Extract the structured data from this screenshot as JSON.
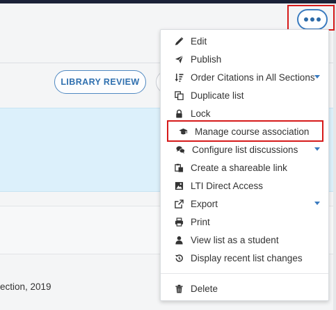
{
  "toolbar": {
    "library_review_label": "LIBRARY REVIEW",
    "more_actions_icon": "ellipsis-icon"
  },
  "content": {
    "citation_fragment": "ection, 2019"
  },
  "menu": {
    "items": [
      {
        "label": "Edit",
        "icon": "pencil-icon",
        "has_submenu": false
      },
      {
        "label": "Publish",
        "icon": "paper-plane-icon",
        "has_submenu": false
      },
      {
        "label": "Order Citations in All Sections",
        "icon": "sort-icon",
        "has_submenu": true
      },
      {
        "label": "Duplicate list",
        "icon": "copy-icon",
        "has_submenu": false
      },
      {
        "label": "Lock",
        "icon": "lock-icon",
        "has_submenu": false
      },
      {
        "label": "Manage course association",
        "icon": "graduation-cap-icon",
        "has_submenu": false
      },
      {
        "label": "Configure list discussions",
        "icon": "comments-icon",
        "has_submenu": true
      },
      {
        "label": "Create a shareable link",
        "icon": "clipboard-icon",
        "has_submenu": false
      },
      {
        "label": "LTI Direct Access",
        "icon": "image-icon",
        "has_submenu": false
      },
      {
        "label": "Export",
        "icon": "external-link-icon",
        "has_submenu": true
      },
      {
        "label": "Print",
        "icon": "printer-icon",
        "has_submenu": false
      },
      {
        "label": "View list as a student",
        "icon": "user-icon",
        "has_submenu": false
      },
      {
        "label": "Display recent list changes",
        "icon": "history-icon",
        "has_submenu": false
      },
      {
        "label": "Delete",
        "icon": "trash-icon",
        "has_submenu": false
      }
    ]
  },
  "colors": {
    "accent": "#3a7bbf",
    "highlight": "#d61a1a",
    "selected_row": "#dcf0fb",
    "top_bar": "#1b2238"
  }
}
